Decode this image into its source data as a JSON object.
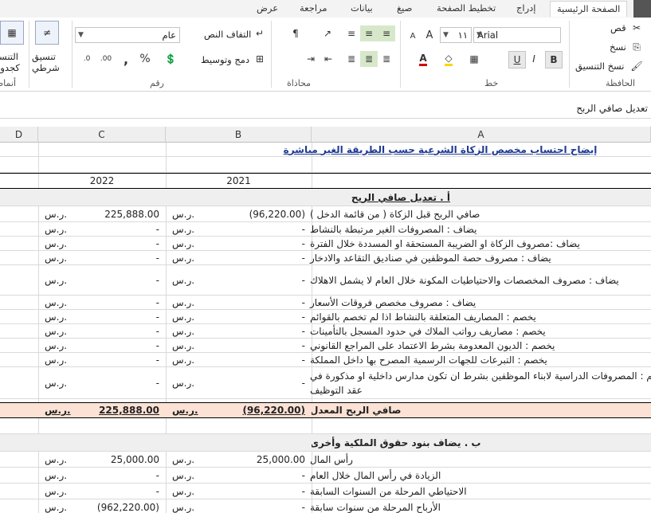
{
  "ribbon_tabs": [
    "عرض",
    "مراجعة",
    "بيانات",
    "صيغ",
    "تخطيط الصفحة",
    "إدراج",
    "الصفحة الرئيسية"
  ],
  "clipboard": {
    "cut": "قص",
    "copy": "نسخ",
    "format_painter": "نسخ التنسيق",
    "group": "الحافظة"
  },
  "font": {
    "name": "Arial",
    "size": "١١",
    "bold": "B",
    "italic": "I",
    "underline": "U",
    "grow": "A",
    "shrink": "A",
    "group": "خط"
  },
  "alignment": {
    "wrap": "التفاف النص",
    "merge": "دمج وتوسيط",
    "group": "محاذاة"
  },
  "number": {
    "format": "عام",
    "percent": "%",
    "comma": ",",
    "group": "رقم"
  },
  "styles": {
    "conditional_line1": "تنسيق",
    "conditional_line2": "شرطي",
    "table_line1": "التنسيق",
    "table_line2": "كجدول",
    "group": "أنماط"
  },
  "formula_bar": {
    "content": "تعديل صافي الربح"
  },
  "columns": [
    "A",
    "B",
    "C",
    "D"
  ],
  "sheet": {
    "title": "إيضاح احتساب مخصص الزكاة الشرعية  حسب الطريقة الغير مباشرة",
    "years": [
      "2021",
      "2022"
    ],
    "currency": "ر.س.",
    "section_a_title": "أ . تعديل صافي الربح",
    "rows": [
      {
        "label": "صافي الربح قبل الزكاة ( من قائمة الدخل )",
        "b": "(96,220.00)",
        "c": "225,888.00"
      },
      {
        "label": "يضاف : المصروفات الغير مرتبطة بالنشاط",
        "b": "-",
        "c": "-"
      },
      {
        "label": "يضاف :مصروف  الزكاة او الضريبة المستحقة او المسددة خلال الفترة",
        "b": "-",
        "c": "-"
      },
      {
        "label": "يضاف : مصروف حصة الموظفين في صناديق التقاعد والادخار",
        "b": "-",
        "c": "-"
      },
      {
        "label": "يضاف : مصروف المخصصات والاحتياطيات المكونة خلال العام لا يشمل الاهلاك",
        "b": "-",
        "c": "-"
      },
      {
        "label": "يضاف : مصروف مخصص فروقات الأسعار",
        "b": "-",
        "c": "-"
      },
      {
        "label": "يخصم : المصاريف المتعلقة بالنشاط اذا لم تخصم بالقوائم",
        "b": "-",
        "c": "-"
      },
      {
        "label": "يخصم : مصاريف رواتب الملاك في حدود المسجل بالتأمينات",
        "b": "-",
        "c": "-"
      },
      {
        "label": "يخصم : الديون المعدومة بشرط الاعتماد على المراجع القانوني",
        "b": "-",
        "c": "-"
      },
      {
        "label": "يخصم : التبرعات للجهات الرسمية المصرح بها داخل المملكة",
        "b": "-",
        "c": "-"
      },
      {
        "label_line1": "يخصم : المصروفات الدراسية لابناء الموظفين بشرط ان تكون مدارس داخلية او مذكورة في",
        "label_line2": "عقد التوظيف",
        "b": "-",
        "c": "-"
      }
    ],
    "adjusted": {
      "label": "صافي الربح المعدل",
      "b": "(96,220.00)",
      "c": "225,888.00"
    },
    "section_b_title": "ب . يضاف بنود حقوق الملكية وأخرى",
    "rows_b": [
      {
        "label": "رأس المال",
        "b": "25,000.00",
        "c": "25,000.00"
      },
      {
        "label": "الزيادة في رأس المال خلال العام",
        "b": "-",
        "c": "-"
      },
      {
        "label": "الاحتياطي  المرحلة من السنوات السابقة",
        "b": "-",
        "c": "-"
      },
      {
        "label": "الأرباح المرحلة  من سنوات سابقة",
        "b": "-",
        "c": "(962,220.00)"
      }
    ]
  },
  "colors": {
    "adjusted_fill": "#fbe2d5",
    "section_fill": "#efefef",
    "title_text": "#1f3a93"
  }
}
